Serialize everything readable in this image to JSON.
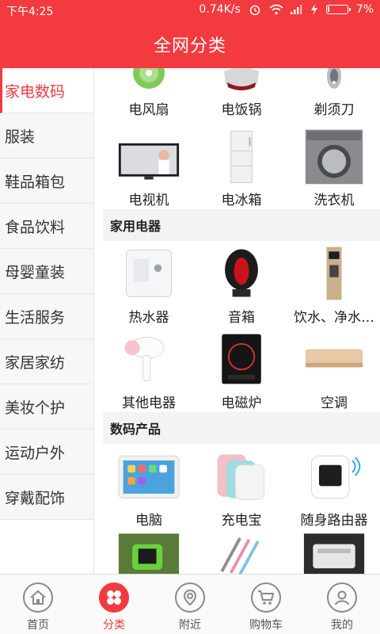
{
  "status_bar": {
    "time": "下午4:25",
    "network_speed": "0.74K/s",
    "battery": "7%",
    "icons": [
      "alarm-icon",
      "wifi-icon",
      "signal-icon",
      "charging-icon",
      "battery-icon"
    ]
  },
  "header": {
    "title": "全网分类"
  },
  "sidebar": {
    "items": [
      {
        "label": "家电数码",
        "active": true
      },
      {
        "label": "服装"
      },
      {
        "label": "鞋品箱包"
      },
      {
        "label": "食品饮料"
      },
      {
        "label": "母婴童装"
      },
      {
        "label": "生活服务"
      },
      {
        "label": "家居家纺"
      },
      {
        "label": "美妆个护"
      },
      {
        "label": "运动户外"
      },
      {
        "label": "穿戴配饰"
      }
    ]
  },
  "content": {
    "top_rows": [
      [
        {
          "label": "电风扇",
          "icon": "fan-image"
        },
        {
          "label": "电饭锅",
          "icon": "rice-cooker-image"
        },
        {
          "label": "剃须刀",
          "icon": "shaver-image"
        }
      ],
      [
        {
          "label": "电视机",
          "icon": "tv-image"
        },
        {
          "label": "电冰箱",
          "icon": "fridge-image"
        },
        {
          "label": "洗衣机",
          "icon": "washing-machine-image"
        }
      ]
    ],
    "sections": [
      {
        "title": "家用电器",
        "rows": [
          [
            {
              "label": "热水器",
              "icon": "water-heater-image"
            },
            {
              "label": "音箱",
              "icon": "speaker-image"
            },
            {
              "label": "饮水、净水…",
              "icon": "water-dispenser-image"
            }
          ],
          [
            {
              "label": "其他电器",
              "icon": "hair-dryer-image"
            },
            {
              "label": "电磁炉",
              "icon": "induction-cooker-image"
            },
            {
              "label": "空调",
              "icon": "air-conditioner-image"
            }
          ]
        ]
      },
      {
        "title": "数码产品",
        "rows": [
          [
            {
              "label": "电脑",
              "icon": "tablet-image"
            },
            {
              "label": "充电宝",
              "icon": "power-bank-image"
            },
            {
              "label": "随身路由器",
              "icon": "pocket-router-image"
            }
          ]
        ]
      }
    ]
  },
  "bottom_nav": {
    "items": [
      {
        "label": "首页",
        "icon": "home-icon"
      },
      {
        "label": "分类",
        "icon": "category-icon",
        "active": true
      },
      {
        "label": "附近",
        "icon": "location-icon"
      },
      {
        "label": "购物车",
        "icon": "cart-icon"
      },
      {
        "label": "我的",
        "icon": "user-icon"
      }
    ]
  },
  "colors": {
    "brand": "#f23a3f",
    "sidebar_bg": "#f7f7f7",
    "section_bg": "#f3f3f3"
  }
}
